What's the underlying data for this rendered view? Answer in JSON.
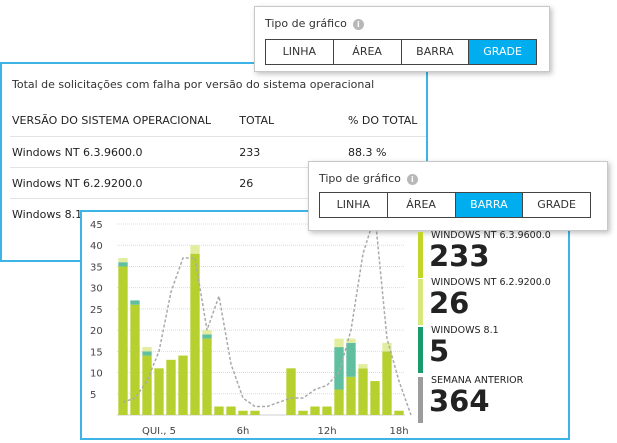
{
  "grid_panel": {
    "title": "Total de solicitações com falha por versão do sistema operacional",
    "columns": [
      "VERSÃO DO SISTEMA OPERACIONAL",
      "TOTAL",
      "% DO TOTAL"
    ],
    "rows": [
      [
        "Windows NT 6.3.9600.0",
        "233",
        "88.3 %"
      ],
      [
        "Windows NT 6.2.9200.0",
        "26",
        ""
      ],
      [
        "Windows 8.1",
        "",
        ""
      ]
    ]
  },
  "selector_top": {
    "label": "Tipo de gráfico",
    "info_icon": "i",
    "options": [
      "LINHA",
      "ÁREA",
      "BARRA",
      "GRADE"
    ],
    "selected": "GRADE"
  },
  "selector_mid": {
    "label": "Tipo de gráfico",
    "info_icon": "i",
    "options": [
      "LINHA",
      "ÁREA",
      "BARRA",
      "GRADE"
    ],
    "selected": "BARRA"
  },
  "legend": [
    {
      "name": "WINDOWS NT 6.3.9600.0",
      "value": "233",
      "color": "#c2d62a"
    },
    {
      "name": "WINDOWS NT 6.2.9200.0",
      "value": "26",
      "color": "#d9e87a"
    },
    {
      "name": "WINDOWS 8.1",
      "value": "5",
      "color": "#1a9a6a"
    },
    {
      "name": "SEMANA ANTERIOR",
      "value": "364",
      "color": "#9c9c9c"
    }
  ],
  "chart_data": {
    "type": "bar",
    "stacked": true,
    "grid": true,
    "ylim": [
      0,
      45
    ],
    "y_ticks": [
      5,
      10,
      15,
      20,
      25,
      30,
      35,
      40,
      45
    ],
    "x_tick_labels": [
      {
        "index": 3,
        "label": "QUI., 5"
      },
      {
        "index": 10,
        "label": "6h"
      },
      {
        "index": 17,
        "label": "12h"
      },
      {
        "index": 23,
        "label": "18h"
      }
    ],
    "colors": {
      "primary": "#b6d12f",
      "secondary": "#5fbf9f",
      "tertiary": "#e2eda0",
      "previous_week": "#aaaaaa"
    },
    "series": [
      {
        "name": "WINDOWS NT 6.3.9600.0",
        "values": [
          35,
          26,
          14,
          11,
          13,
          14,
          38,
          18,
          2,
          2,
          1,
          1,
          0,
          0,
          11,
          1,
          2,
          2,
          6,
          9,
          11,
          8,
          15,
          1
        ]
      },
      {
        "name": "WINDOWS 8.1",
        "values": [
          1,
          1,
          1,
          0,
          0,
          0,
          0,
          1,
          0,
          0,
          0,
          0,
          0,
          0,
          0,
          0,
          0,
          0,
          10,
          8,
          0,
          0,
          0,
          0
        ]
      },
      {
        "name": "WINDOWS NT 6.2.9200.0",
        "values": [
          1,
          0,
          1,
          0,
          0,
          0,
          2,
          1,
          0,
          0,
          0,
          0,
          0,
          0,
          0,
          0,
          0,
          0,
          2,
          1,
          1,
          0,
          2,
          0
        ]
      },
      {
        "name": "SEMANA ANTERIOR",
        "values": [
          3,
          4,
          8,
          15,
          29,
          37,
          37,
          20,
          28,
          12,
          4,
          2,
          2,
          3,
          4,
          4,
          6,
          7,
          10,
          20,
          38,
          47,
          18,
          8,
          0
        ]
      }
    ]
  }
}
